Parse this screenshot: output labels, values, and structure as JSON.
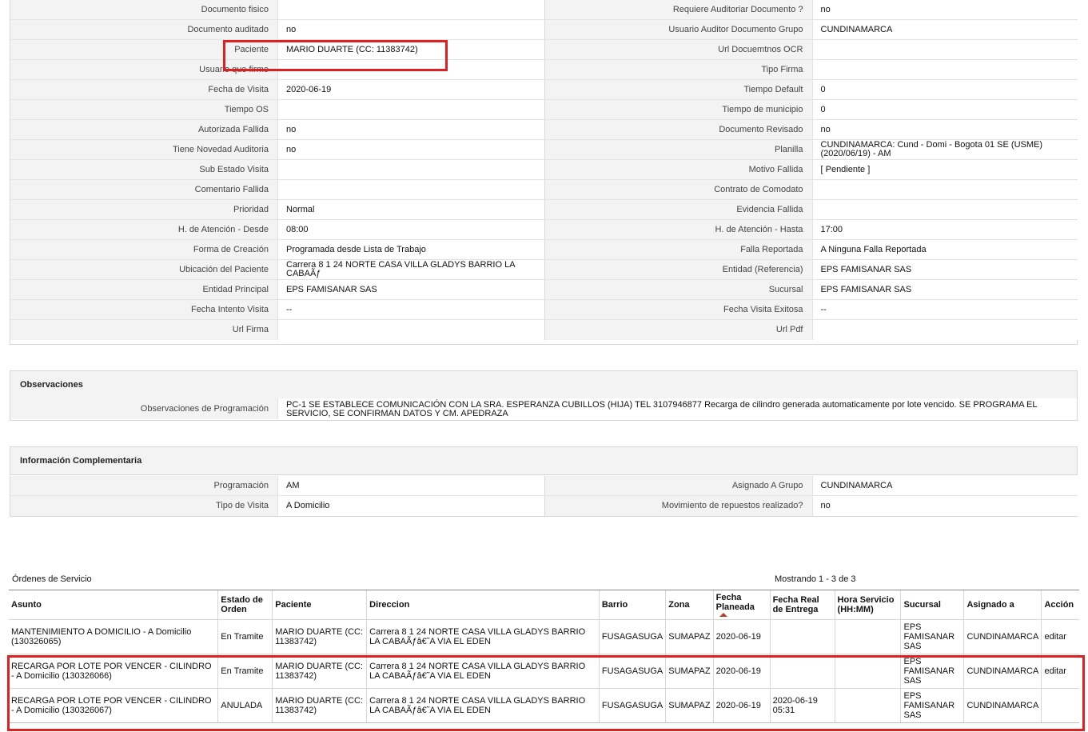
{
  "main_rows": [
    {
      "l1": "Documento fisico",
      "v1": "",
      "l2": "Requiere Auditoriar Documento ?",
      "v2": "no"
    },
    {
      "l1": "Documento auditado",
      "v1": "no",
      "l2": "Usuario Auditor Documento Grupo",
      "v2": "CUNDINAMARCA"
    },
    {
      "l1": "Paciente",
      "v1": "MARIO DUARTE (CC: 11383742)",
      "l2": "Url Docuemtnos OCR",
      "v2": ""
    },
    {
      "l1": "Usuario que firmo",
      "v1": "",
      "l2": "Tipo Firma",
      "v2": ""
    },
    {
      "l1": "Fecha de Visita",
      "v1": "2020-06-19",
      "l2": "Tiempo Default",
      "v2": "0"
    },
    {
      "l1": "Tiempo OS",
      "v1": "",
      "l2": "Tiempo de municipio",
      "v2": "0"
    },
    {
      "l1": "Autorizada Fallida",
      "v1": "no",
      "l2": "Documento Revisado",
      "v2": "no"
    },
    {
      "l1": "Tiene Novedad Auditoria",
      "v1": "no",
      "l2": "Planilla",
      "v2": "CUNDINAMARCA: Cund - Domi - Bogota 01 SE (USME) (2020/06/19) - AM"
    },
    {
      "l1": "Sub Estado Visita",
      "v1": "",
      "l2": "Motivo Fallida",
      "v2": "[ Pendiente ]"
    },
    {
      "l1": "Comentario Fallida",
      "v1": "",
      "l2": "Contrato de Comodato",
      "v2": ""
    },
    {
      "l1": "Prioridad",
      "v1": "Normal",
      "l2": "Evidencia Fallida",
      "v2": ""
    },
    {
      "l1": "H. de Atención - Desde",
      "v1": "08:00",
      "l2": "H. de Atención - Hasta",
      "v2": "17:00"
    },
    {
      "l1": "Forma de Creación",
      "v1": "Programada desde Lista de Trabajo",
      "l2": "Falla Reportada",
      "v2": "A Ninguna Falla Reportada"
    },
    {
      "l1": "Ubicación del Paciente",
      "v1": "Carrera 8 1 24 NORTE CASA VILLA GLADYS BARRIO LA CABAÃƒ",
      "l2": "Entidad (Referencia)",
      "v2": "EPS FAMISANAR SAS"
    },
    {
      "l1": "Entidad Principal",
      "v1": "EPS FAMISANAR SAS",
      "l2": "Sucursal",
      "v2": "EPS FAMISANAR SAS"
    },
    {
      "l1": "Fecha Intento Visita",
      "v1": "--",
      "l2": "Fecha Visita Exitosa",
      "v2": "--"
    },
    {
      "l1": "Url Firma",
      "v1": "",
      "l2": "Url Pdf",
      "v2": ""
    }
  ],
  "observaciones": {
    "title": "Observaciones",
    "label": "Observaciones de Programación",
    "value": "PC-1 SE ESTABLECE COMUNICACIÓN CON LA SRA. ESPERANZA CUBILLOS (HIJA) TEL 3107946877 Recarga de cilindro generada automaticamente por lote vencido. SE PROGRAMA EL SERVICIO, SE CONFIRMAN DATOS Y CM. APEDRAZA"
  },
  "complementaria": {
    "title": "Información Complementaria",
    "rows": [
      {
        "l1": "Programación",
        "v1": "AM",
        "l2": "Asignado A Grupo",
        "v2": "CUNDINAMARCA"
      },
      {
        "l1": "Tipo de Visita",
        "v1": "A Domicilio",
        "l2": "Movimiento de repuestos realizado?",
        "v2": "no"
      }
    ]
  },
  "orders": {
    "title": "Órdenes de Servicio",
    "count_text": "Mostrando 1 - 3 de 3",
    "headers": [
      "Asunto",
      "Estado de Orden",
      "Paciente",
      "Direccion",
      "Barrio",
      "Zona",
      "Fecha Planeada",
      "Fecha Real de Entrega",
      "Hora Servicio (HH:MM)",
      "Sucursal",
      "Asignado a",
      "Acción"
    ],
    "rows": [
      [
        "MANTENIMIENTO A DOMICILIO - A Domicilio (130326065)",
        "En Tramite",
        "MARIO DUARTE (CC: 11383742)",
        "Carrera 8 1 24 NORTE CASA VILLA GLADYS BARRIO LA CABAÃƒâ€˜A VIA EL EDEN",
        "FUSAGASUGA",
        "SUMAPAZ",
        "2020-06-19",
        "",
        "",
        "EPS FAMISANAR SAS",
        "CUNDINAMARCA",
        "editar"
      ],
      [
        "RECARGA POR LOTE POR VENCER - CILINDRO - A Domicilio (130326066)",
        "En Tramite",
        "MARIO DUARTE (CC: 11383742)",
        "Carrera 8 1 24 NORTE CASA VILLA GLADYS BARRIO LA CABAÃƒâ€˜A VIA EL EDEN",
        "FUSAGASUGA",
        "SUMAPAZ",
        "2020-06-19",
        "",
        "",
        "EPS FAMISANAR SAS",
        "CUNDINAMARCA",
        "editar"
      ],
      [
        "RECARGA POR LOTE POR VENCER - CILINDRO - A Domicilio (130326067)",
        "ANULADA",
        "MARIO DUARTE (CC: 11383742)",
        "Carrera 8 1 24 NORTE CASA VILLA GLADYS BARRIO LA CABAÃƒâ€˜A VIA EL EDEN",
        "FUSAGASUGA",
        "SUMAPAZ",
        "2020-06-19",
        "2020-06-19 05:31",
        "",
        "EPS FAMISANAR SAS",
        "CUNDINAMARCA",
        ""
      ]
    ]
  },
  "colors": {
    "highlight": "#e02020",
    "label_bg": "#f3f3f3"
  }
}
